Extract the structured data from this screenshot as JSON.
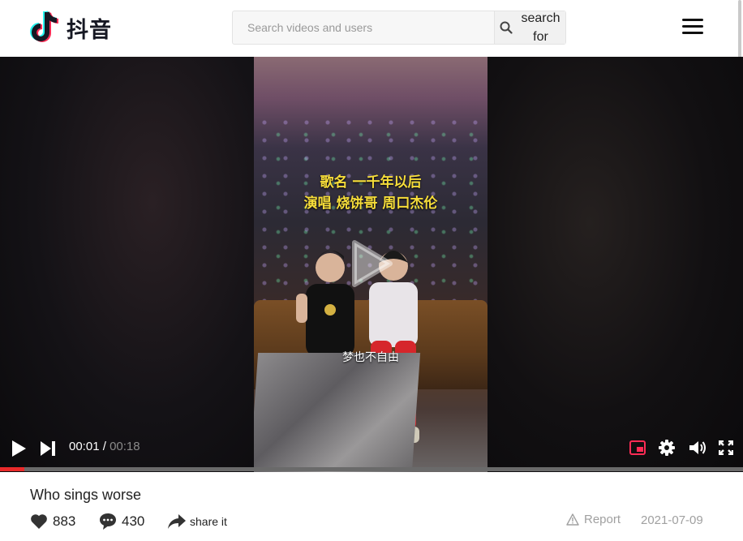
{
  "app": {
    "logo_text": "抖音"
  },
  "search": {
    "placeholder": "Search videos and users",
    "button_label": "search for"
  },
  "video": {
    "caption_line1": "歌名 一千年以后",
    "caption_line2": "演唱 烧饼哥 周口杰伦",
    "lyric": "梦也不自由",
    "current_time": "00:01",
    "separator": "/",
    "duration": "00:18",
    "progress_fraction": 0.033
  },
  "post": {
    "title": "Who sings worse",
    "likes": "883",
    "comments": "430",
    "share_label": "share it",
    "report_label": "Report",
    "date": "2021-07-09"
  },
  "colors": {
    "accent": "#ea2a2a",
    "caption": "#f6dd3a",
    "pip_icon": "#ff2b55"
  }
}
